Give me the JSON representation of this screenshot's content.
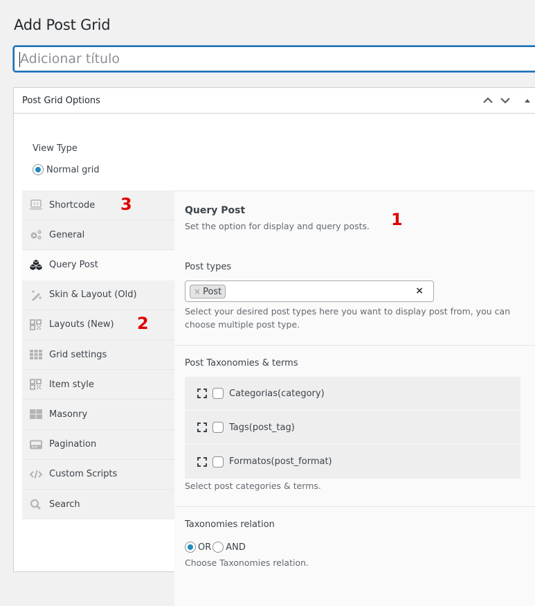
{
  "page": {
    "title": "Add Post Grid",
    "title_input_placeholder": "Adicionar título",
    "title_input_value": ""
  },
  "postbox": {
    "title": "Post Grid Options",
    "header_buttons": [
      {
        "name": "move-up",
        "icon": "chevron-up-icon"
      },
      {
        "name": "move-down",
        "icon": "chevron-down-icon"
      },
      {
        "name": "toggle-panel",
        "icon": "triangle-up-icon"
      }
    ]
  },
  "view_type": {
    "label": "View Type",
    "options": [
      {
        "label": "Normal grid",
        "checked": true
      }
    ]
  },
  "sidebar": {
    "items": [
      {
        "label": "Shortcode",
        "icon": "laptop-code-icon",
        "active": false
      },
      {
        "label": "General",
        "icon": "gears-icon",
        "active": false
      },
      {
        "label": "Query Post",
        "icon": "cubes-icon",
        "active": true
      },
      {
        "label": "Skin & Layout (Old)",
        "icon": "magic-wand-icon",
        "active": false
      },
      {
        "label": "Layouts (New)",
        "icon": "qrcode-icon",
        "active": false
      },
      {
        "label": "Grid settings",
        "icon": "grid-icon",
        "active": false
      },
      {
        "label": "Item style",
        "icon": "qrcode-icon",
        "active": false
      },
      {
        "label": "Masonry",
        "icon": "masonry-icon",
        "active": false
      },
      {
        "label": "Pagination",
        "icon": "pagination-icon",
        "active": false
      },
      {
        "label": "Custom Scripts",
        "icon": "code-icon",
        "active": false
      },
      {
        "label": "Search",
        "icon": "search-icon",
        "active": false
      }
    ]
  },
  "annotations": {
    "one": "1",
    "two": "2",
    "three": "3",
    "color": "#e00000"
  },
  "query_post": {
    "title": "Query Post",
    "description": "Set the option for display and query posts.",
    "post_types": {
      "label": "Post types",
      "selected": [
        "Post"
      ],
      "chip_remove": "×",
      "clear": "×",
      "help": "Select your desired post types here you want to display post from, you can choose multiple post type."
    },
    "taxonomies": {
      "label": "Post Taxonomies & terms",
      "items": [
        {
          "label": "Categorias(category)",
          "checked": false
        },
        {
          "label": "Tags(post_tag)",
          "checked": false
        },
        {
          "label": "Formatos(post_format)",
          "checked": false
        }
      ],
      "help": "Select post categories & terms."
    },
    "relation": {
      "label": "Taxonomies relation",
      "options": [
        {
          "label": "OR",
          "checked": true
        },
        {
          "label": "AND",
          "checked": false
        }
      ],
      "help": "Choose Taxonomies relation."
    }
  },
  "colors": {
    "accent": "#2271b1",
    "radio": "#1e8cbe"
  }
}
